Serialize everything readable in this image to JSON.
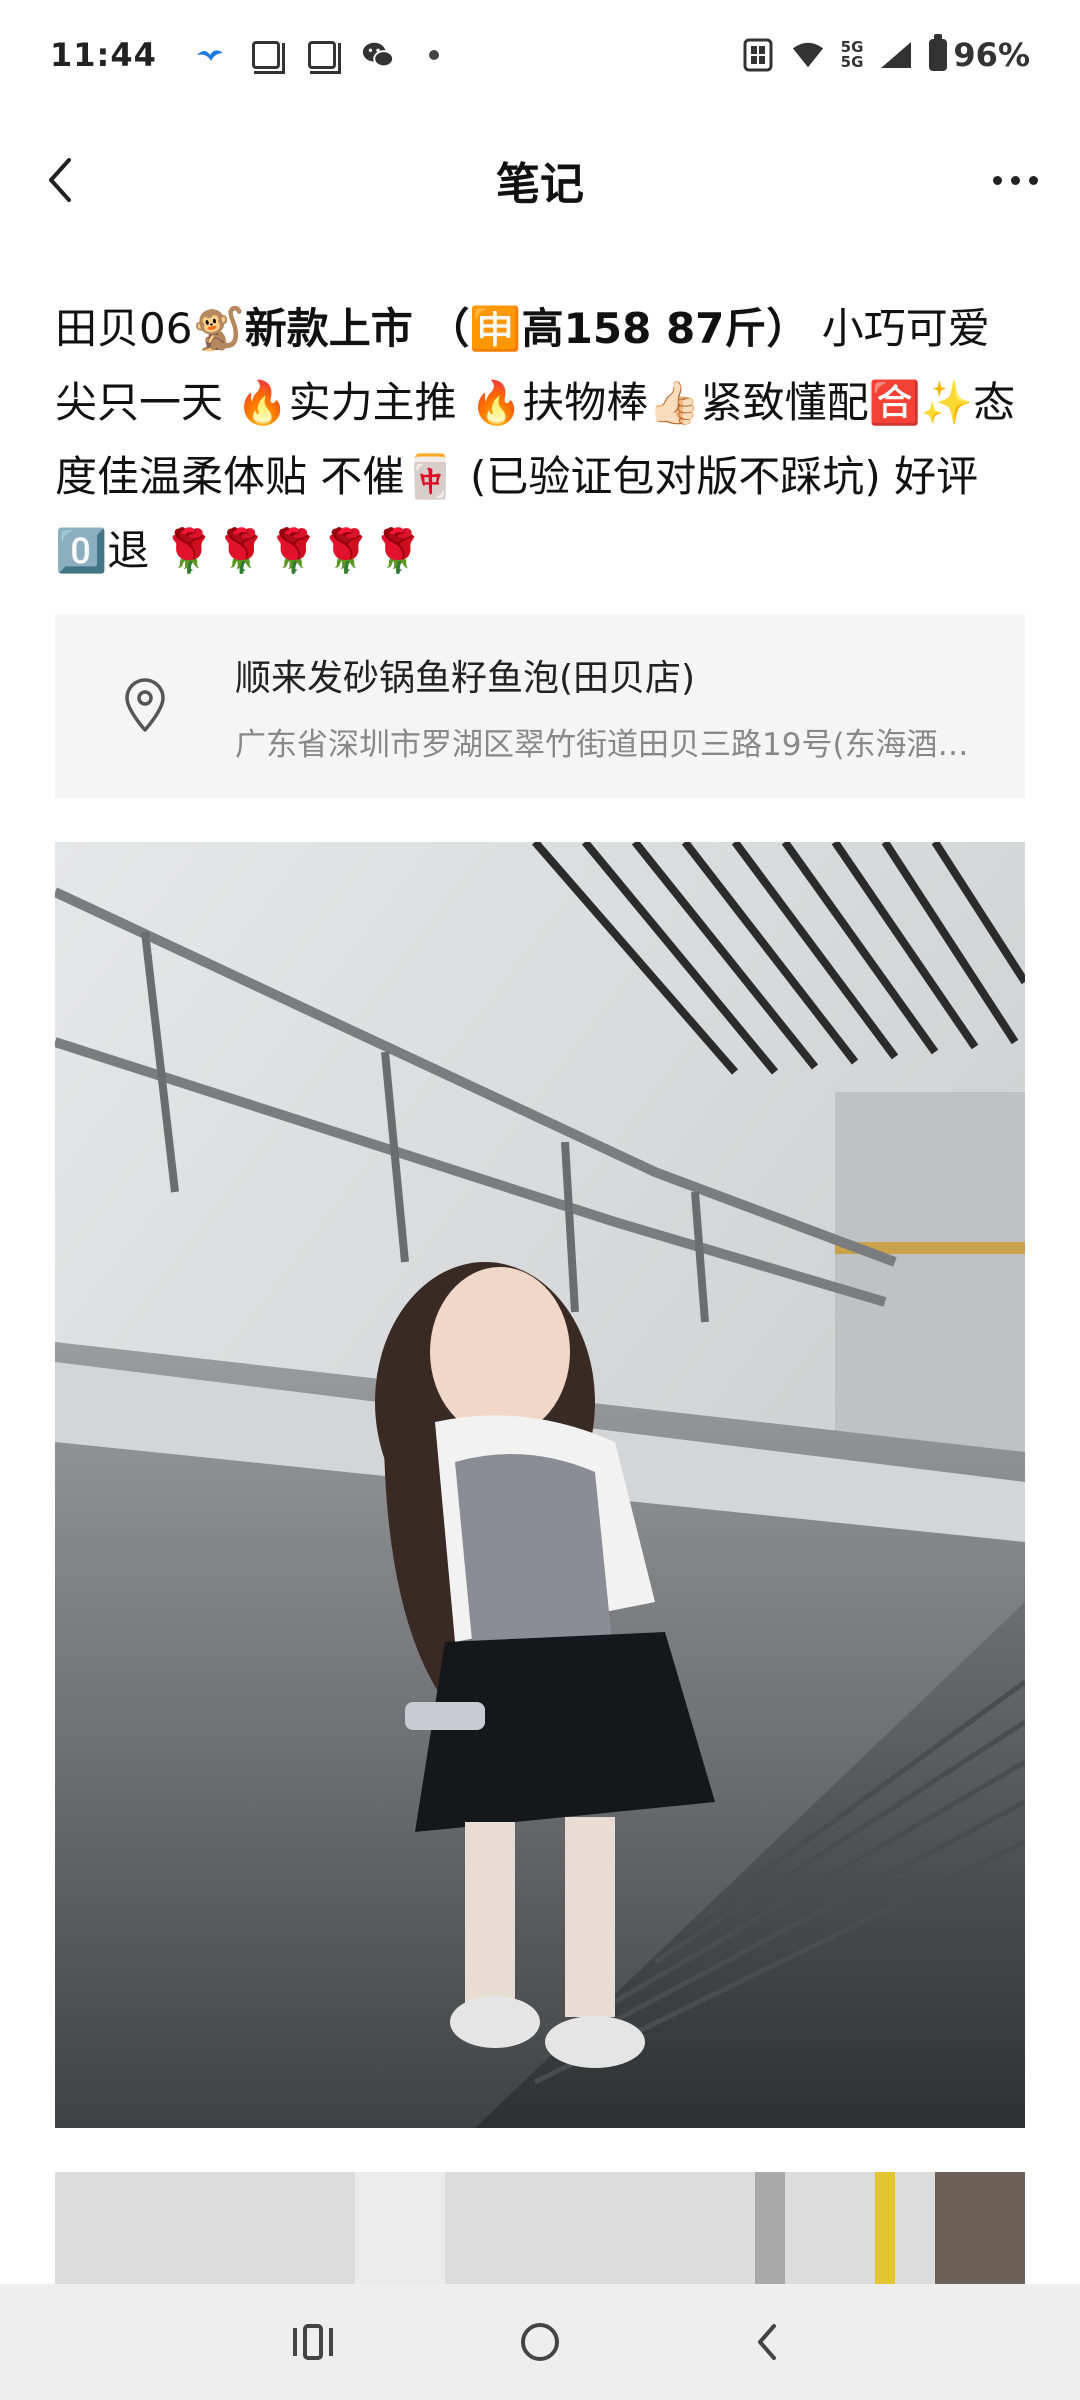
{
  "status_bar": {
    "time": "11:44",
    "network_top": "5G",
    "network_bottom": "5G",
    "battery": "96%",
    "icons": [
      "bird-icon",
      "copy-icon",
      "copy-icon",
      "wechat-icon",
      "dot-icon",
      "nfc-icon",
      "wifi-icon",
      "signal-icon",
      "battery-icon"
    ]
  },
  "header": {
    "title": "笔记",
    "back_icon": "chevron-left-icon",
    "more_icon": "more-dots-icon"
  },
  "note": {
    "part1": "田贝06🐒",
    "part2": "新款上市 （🈸高158 87斤）",
    "part3": " 小巧可爱   尖只一天 🔥实力主推 🔥扶物棒👍🏻紧致懂配🈴✨态度佳温柔体贴 不催🀄 (已验证包对版不踩坑)  好评 0️⃣退 🌹🌹🌹🌹🌹"
  },
  "location": {
    "name": "顺来发砂锅鱼籽鱼泡(田贝店)",
    "address": "广东省深圳市罗湖区翠竹街道田贝三路19号(东海酒…",
    "icon": "location-pin-icon"
  },
  "nav_bar": {
    "icons": [
      "recent-apps-icon",
      "home-icon",
      "back-icon"
    ]
  }
}
